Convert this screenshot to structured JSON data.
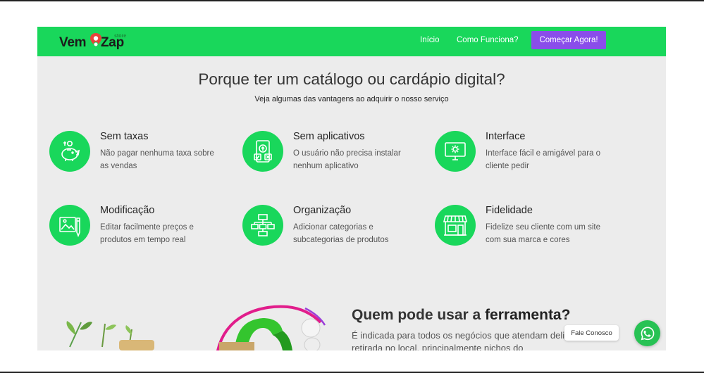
{
  "navbar": {
    "logo": {
      "part1": "Vem",
      "part2": "Zap",
      "small": "store"
    },
    "links": [
      {
        "label": "Início"
      },
      {
        "label": "Como Funciona?"
      }
    ],
    "cta_label": "Começar Agora!"
  },
  "hero": {
    "title": "Porque ter um catálogo ou cardápio digital?",
    "subtitle": "Veja algumas das vantagens ao adquirir o nosso serviço"
  },
  "features": [
    {
      "icon": "piggy-bank-icon",
      "title": "Sem taxas",
      "desc": "Não pagar nenhuma taxa sobre as vendas"
    },
    {
      "icon": "mobile-apps-icon",
      "title": "Sem aplicativos",
      "desc": "O usuário não precisa instalar nenhum aplicativo"
    },
    {
      "icon": "monitor-gear-icon",
      "title": "Interface",
      "desc": "Interface fácil e amigável para o cliente pedir"
    },
    {
      "icon": "image-edit-icon",
      "title": "Modificação",
      "desc": "Editar facilmente preços e produtos em tempo real"
    },
    {
      "icon": "flowchart-icon",
      "title": "Organização",
      "desc": "Adicionar categorias e subcategorias de produtos"
    },
    {
      "icon": "storefront-icon",
      "title": "Fidelidade",
      "desc": "Fidelize seu cliente com um site com sua marca e cores"
    }
  ],
  "who": {
    "title_prefix": "Quem pode usar a ",
    "title_bold": "ferramenta?",
    "desc": "É indicada para todos os negócios que atendam delivery ou retirada no local, principalmente nichos do"
  },
  "chat": {
    "label": "Fale Conosco",
    "icon": "whatsapp-icon"
  },
  "colors": {
    "brand_green": "#19d75b",
    "cta_purple": "#8a4dea",
    "page_bg": "#ececec"
  }
}
